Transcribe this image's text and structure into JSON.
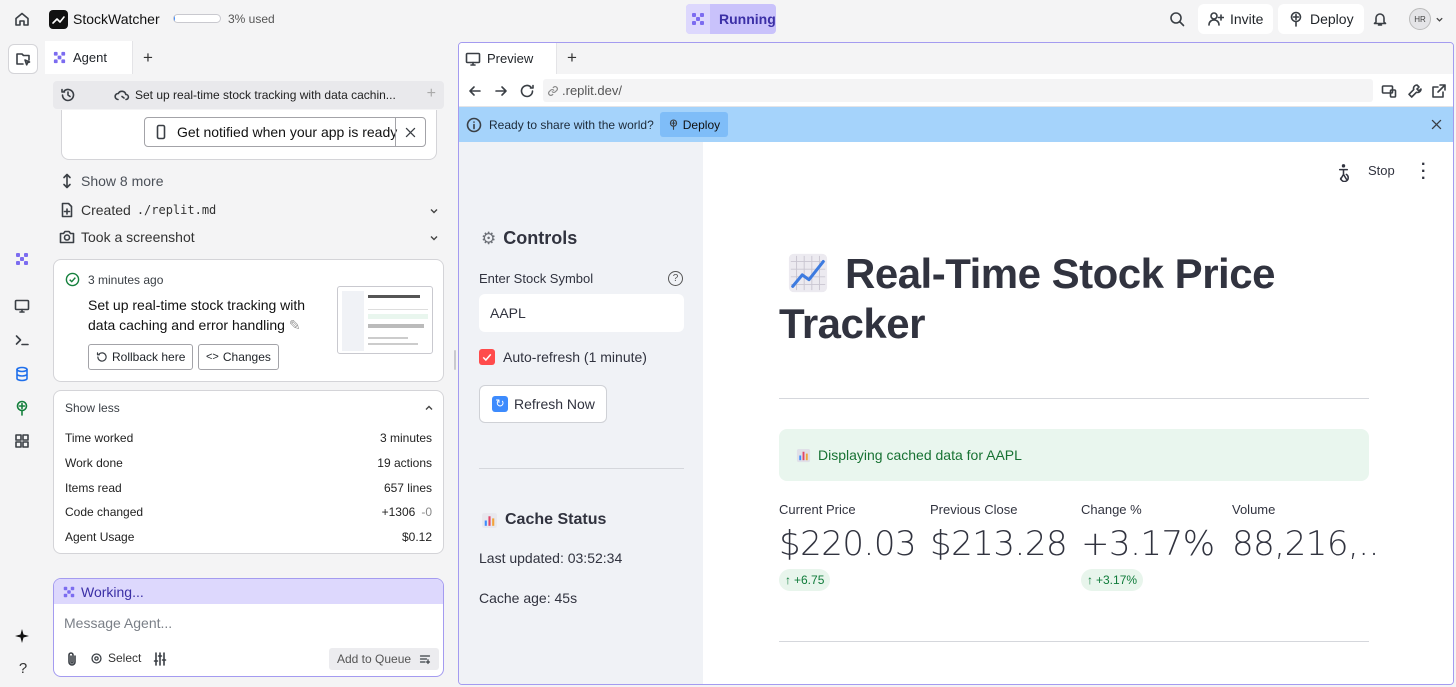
{
  "app": {
    "name": "StockWatcher",
    "usage": "3% used",
    "usage_fraction": 0.03
  },
  "topbar": {
    "status": "Running",
    "invite": "Invite",
    "deploy": "Deploy",
    "avatar": "HR"
  },
  "agent": {
    "tab": "Agent",
    "task_title": "Set up real-time stock tracking with data cachin...",
    "notify": "Get notified when your app is ready",
    "show_more": "Show 8 more",
    "created_prefix": "Created",
    "created_file": "./replit.md",
    "screenshot": "Took a screenshot",
    "checkpoint": {
      "time": "3 minutes ago",
      "desc": "Set up real-time stock tracking with data caching and error handling",
      "rollback": "Rollback here",
      "changes": "Changes"
    },
    "stats": {
      "toggle": "Show less",
      "rows": [
        {
          "label": "Time worked",
          "value": "3 minutes"
        },
        {
          "label": "Work done",
          "value": "19 actions"
        },
        {
          "label": "Items read",
          "value": "657 lines"
        },
        {
          "label": "Code changed",
          "value": "+1306",
          "extra": "-0"
        },
        {
          "label": "Agent Usage",
          "value": "$0.12"
        }
      ]
    },
    "working": "Working...",
    "input_placeholder": "Message Agent...",
    "select": "Select",
    "queue": "Add to Queue"
  },
  "preview": {
    "tab": "Preview",
    "url": ".replit.dev/",
    "banner_text": "Ready to share with the world?",
    "banner_deploy": "Deploy",
    "stop": "Stop",
    "sidebar": {
      "controls_title": "Controls",
      "symbol_label": "Enter Stock Symbol",
      "symbol_value": "AAPL",
      "autorefresh_label": "Auto-refresh (1 minute)",
      "refresh_button": "Refresh Now",
      "cache_title": "Cache Status",
      "last_updated": "Last updated: 03:52:34",
      "cache_age": "Cache age: 45s"
    },
    "main": {
      "title_line1": "Real-Time Stock Price",
      "title_line2": "Tracker",
      "info": "Displaying cached data for AAPL",
      "metrics": [
        {
          "label": "Current Price",
          "value": "$220.03",
          "delta": "+6.75"
        },
        {
          "label": "Previous Close",
          "value": "$213.28",
          "delta": ""
        },
        {
          "label": "Change %",
          "value": "+3.17%",
          "delta": "+3.17%"
        },
        {
          "label": "Volume",
          "value": "88,216,...",
          "delta": ""
        }
      ]
    }
  },
  "colors": {
    "accent": "#7c6cf0",
    "running_bg": "#c9c2fb",
    "banner_bg": "#a5d3fb",
    "info_bg": "#e9f6ee",
    "success": "#0f7b3a"
  }
}
